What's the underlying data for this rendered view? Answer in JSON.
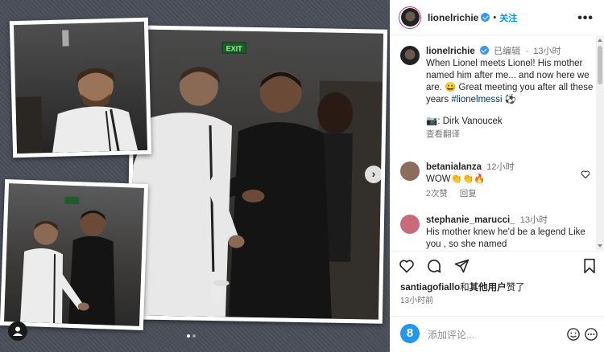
{
  "post": {
    "username": "lionelrichie",
    "follow_label": "关注",
    "more_label": "•••",
    "exit_sign": "EXIT",
    "nav_next": "›",
    "carousel_total": 2,
    "carousel_active": 1
  },
  "caption": {
    "username": "lionelrichie",
    "edited": "已编辑",
    "time": "13小时",
    "text": "When Lionel meets Lionel! His mother named him after me... and now here we are. 😀 Great meeting you after all these years",
    "hashtag": "#lionelmessi",
    "emoji_end": "⚽",
    "credit": "📷: Dirk Vanoucek",
    "translate": "查看翻译"
  },
  "comments": [
    {
      "username": "betanialanza",
      "time": "12小时",
      "text": "WOW👏👏🔥",
      "likes": "2次赞",
      "reply": "回复",
      "avatar_color": "#8a6d5a"
    },
    {
      "username": "stephanie_marucci_",
      "time": "13小时",
      "text": "His mother knew he'd be a legend Like you , so she named",
      "avatar_color": "#c86a7a"
    }
  ],
  "actions": {
    "liked_by_user": "santiagofiallo",
    "liked_connector": "和",
    "liked_others": "其他用户",
    "liked_suffix": "赞了",
    "timestamp": "13小时前",
    "add_comment_placeholder": "添加评论...",
    "ext_icon_label": "8"
  },
  "colors": {
    "accent": "#0095f6",
    "verified": "#3897f0",
    "hashtag": "#00376b"
  },
  "icons": [
    "heart-icon",
    "comment-icon",
    "share-icon",
    "bookmark-icon",
    "emoji-icon",
    "more-icon",
    "verified-icon",
    "user-tag-icon",
    "next-arrow-icon"
  ]
}
